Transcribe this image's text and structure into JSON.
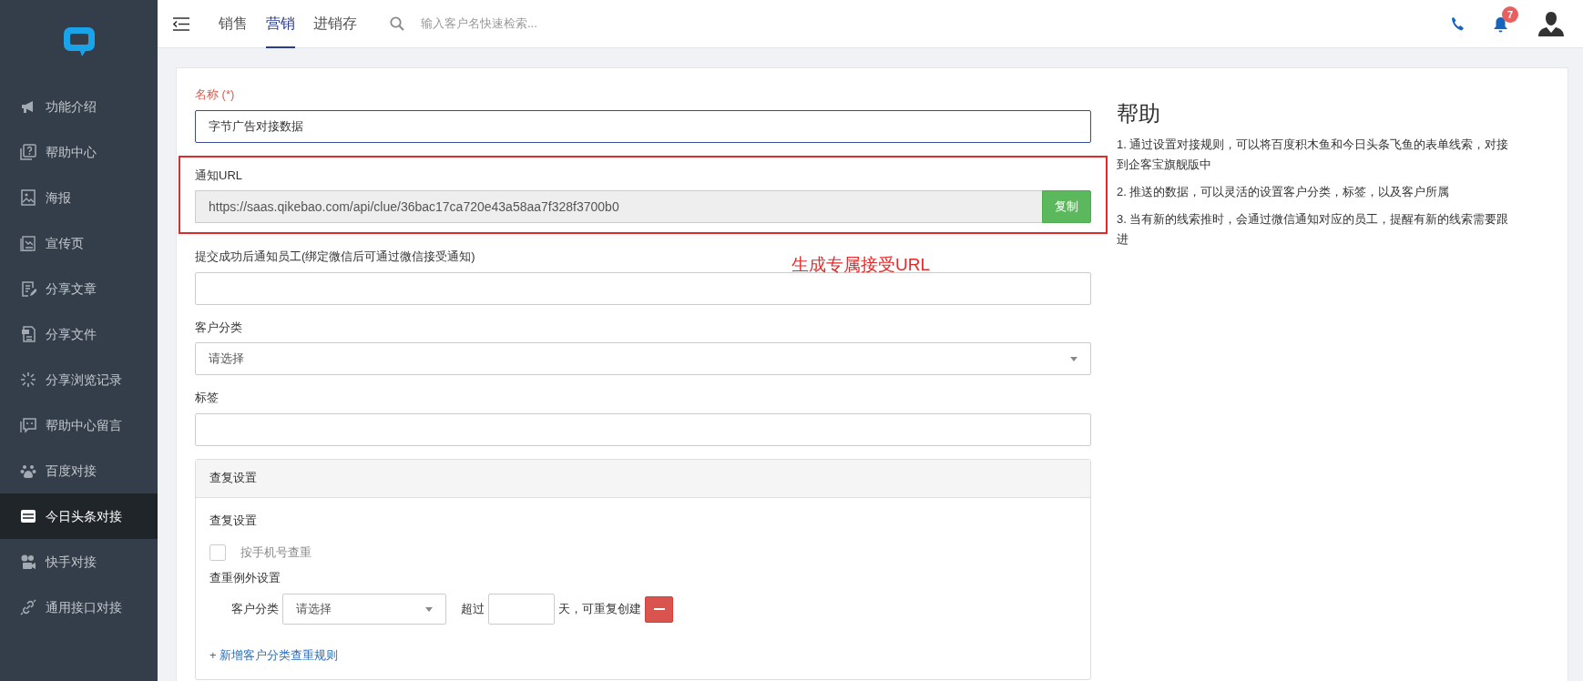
{
  "sidebar": {
    "items": [
      {
        "label": "功能介绍",
        "selected": false
      },
      {
        "label": "帮助中心",
        "selected": false
      },
      {
        "label": "海报",
        "selected": false
      },
      {
        "label": "宣传页",
        "selected": false
      },
      {
        "label": "分享文章",
        "selected": false
      },
      {
        "label": "分享文件",
        "selected": false
      },
      {
        "label": "分享浏览记录",
        "selected": false
      },
      {
        "label": "帮助中心留言",
        "selected": false
      },
      {
        "label": "百度对接",
        "selected": false
      },
      {
        "label": "今日头条对接",
        "selected": true
      },
      {
        "label": "快手对接",
        "selected": false
      },
      {
        "label": "通用接口对接",
        "selected": false
      }
    ]
  },
  "topbar": {
    "tabs": [
      {
        "label": "销售",
        "selected": false
      },
      {
        "label": "营销",
        "selected": true
      },
      {
        "label": "进销存",
        "selected": false
      }
    ],
    "search": {
      "placeholder": "输入客户名快速检索..."
    },
    "notification_count": "7"
  },
  "form": {
    "name": {
      "label": "名称 (*)",
      "value": "字节广告对接数据"
    },
    "notify_url": {
      "label": "通知URL",
      "value": "https://saas.qikebao.com/api/clue/36bac17ca720e43a58aa7f328f3700b0",
      "copy_button": "复制"
    },
    "notify_staff": {
      "label": "提交成功后通知员工(绑定微信后可通过微信接受通知)"
    },
    "customer_category": {
      "label": "客户分类",
      "placeholder": "请选择"
    },
    "tags": {
      "label": "标签"
    }
  },
  "dedup_panel": {
    "title": "查复设置",
    "section_label": "查复设置",
    "checkbox": {
      "label": "按手机号查重",
      "checked": false
    },
    "exception_label": "查重例外设置",
    "rule": {
      "category_label": "客户分类",
      "category_placeholder": "请选择",
      "over_label": "超过",
      "days_label": "天，可重复创建"
    },
    "add_rule_link": "+ 新增客户分类查重规则"
  },
  "help": {
    "title": "帮助",
    "paragraphs": [
      "1. 通过设置对接规则，可以将百度积木鱼和今日头条飞鱼的表单线索，对接到企客宝旗舰版中",
      "2. 推送的数据，可以灵活的设置客户分类，标签，以及客户所属",
      "3. 当有新的线索推时，会通过微信通知对应的员工，提醒有新的线索需要跟进"
    ]
  },
  "annotation": {
    "text": "生成专属接受URL"
  }
}
